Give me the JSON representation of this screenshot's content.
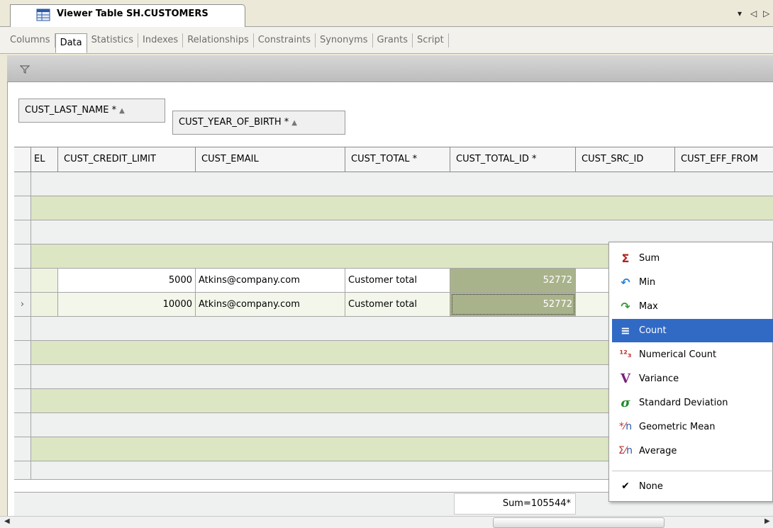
{
  "editor": {
    "title": "Viewer Table SH.CUSTOMERS",
    "controls": [
      "▾",
      "◁",
      "▷"
    ]
  },
  "subtabs": [
    "Columns",
    "Data",
    "Statistics",
    "Indexes",
    "Relationships",
    "Constraints",
    "Synonyms",
    "Grants",
    "Script"
  ],
  "filter_icon": "filter-icon",
  "grouping": {
    "group1": "CUST_LAST_NAME *",
    "group2": "CUST_YEAR_OF_BIRTH *"
  },
  "grid": {
    "columns": [
      "EL",
      "CUST_CREDIT_LIMIT",
      "CUST_EMAIL",
      "CUST_TOTAL *",
      "CUST_TOTAL_ID *",
      "CUST_SRC_ID",
      "CUST_EFF_FROM"
    ],
    "rows": [
      {
        "credit_limit": "5000",
        "email": "Atkins@company.com",
        "total": "Customer total",
        "total_id": "52772"
      },
      {
        "credit_limit": "10000",
        "email": "Atkins@company.com",
        "total": "Customer total",
        "total_id": "52772"
      }
    ],
    "current_row_marker": "›",
    "footer_sum": "Sum=105544*"
  },
  "menu": {
    "items": [
      {
        "label": "Sum",
        "icon": "sigma-icon",
        "glyph": "Σ",
        "color": "#b22222"
      },
      {
        "label": "Min",
        "icon": "min-icon",
        "glyph": "↶",
        "color": "#2a86d4"
      },
      {
        "label": "Max",
        "icon": "max-icon",
        "glyph": "↷",
        "color": "#3a9a3a"
      },
      {
        "label": "Count",
        "icon": "count-icon",
        "glyph": "≡",
        "color": "#ffffff"
      },
      {
        "label": "Numerical Count",
        "icon": "numerical-count-icon",
        "glyph": "⅓",
        "color": "#c03030"
      },
      {
        "label": "Variance",
        "icon": "variance-icon",
        "glyph": "V",
        "color": "#7a1f7a"
      },
      {
        "label": "Standard Deviation",
        "icon": "sigma-lower-icon",
        "glyph": "σ",
        "color": "#1f8a2a"
      },
      {
        "label": "Geometric Mean",
        "icon": "geometric-mean-icon",
        "glyph": "*⁄ₙ",
        "color": "#c03030"
      },
      {
        "label": "Average",
        "icon": "average-icon",
        "glyph": "Σ⁄ₙ",
        "color": "#c03030"
      },
      {
        "label": "None",
        "icon": "check-icon",
        "glyph": "✔",
        "color": "#000000"
      }
    ],
    "selected": "Count"
  },
  "colors": {
    "accent_selection": "#316ac5",
    "group_row_green": "#dce6c3",
    "group_row_gray": "#eff0f0",
    "highlight_cell": "#a9b38b"
  }
}
